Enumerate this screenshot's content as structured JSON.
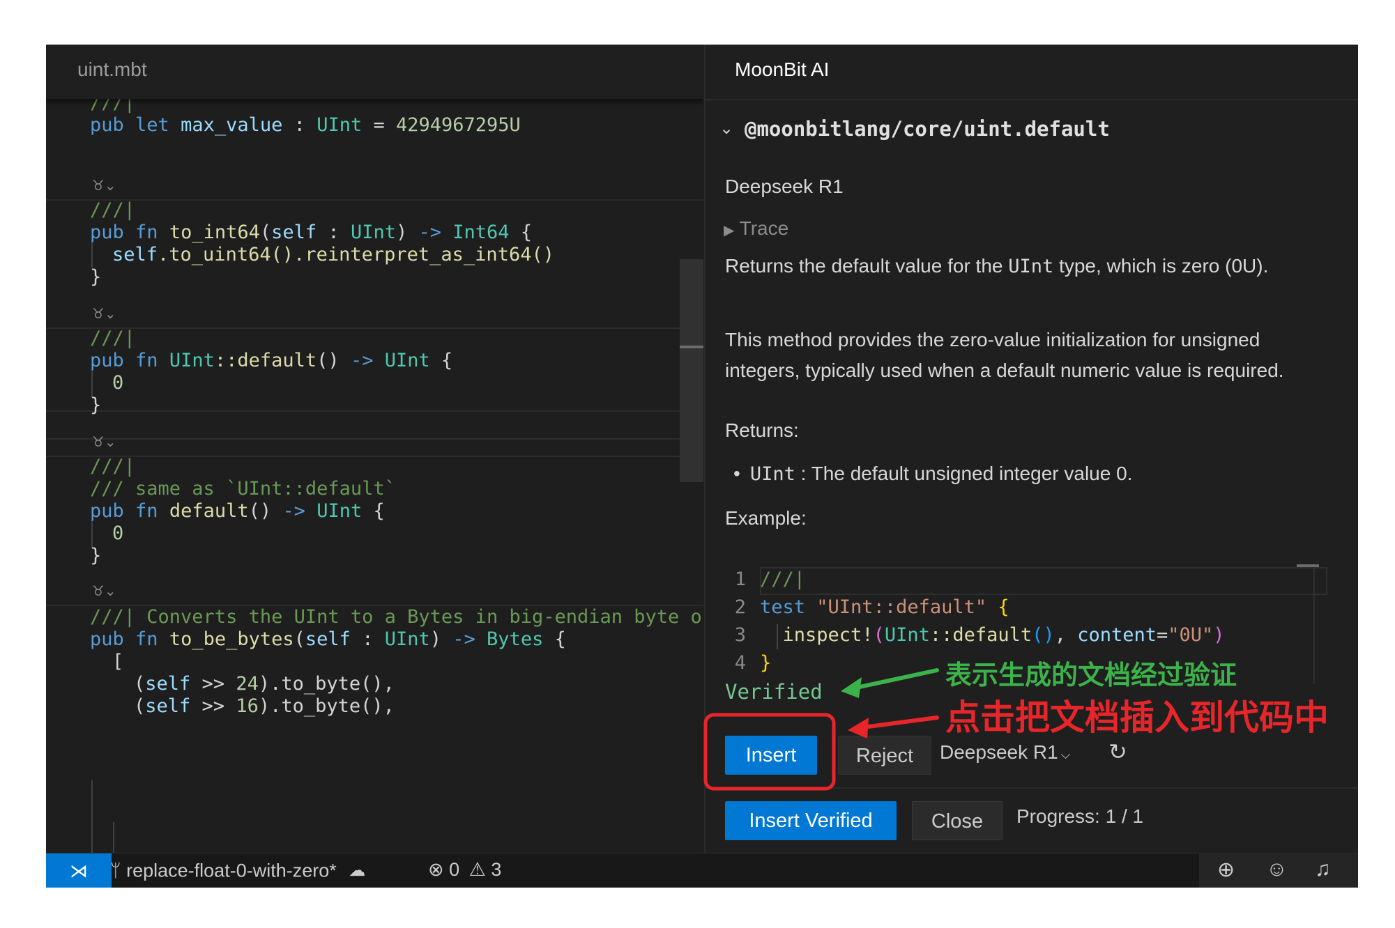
{
  "editor": {
    "tab_label": "uint.mbt",
    "gutter_marker": "♉︎⌄",
    "code": {
      "l0": "///|",
      "l1": {
        "kw": "pub",
        "kw2": "let",
        "name": "max_value",
        "colon": " : ",
        "ty": "UInt",
        "eq": " = ",
        "num": "4294967295U"
      },
      "l2": "///|",
      "l3": {
        "kw": "pub",
        "kw2": "fn",
        "name": "to_int64",
        "p": "(",
        "self": "self",
        "colon": " : ",
        "ty": "UInt",
        "close": ") ",
        "arrow": "->",
        "ret": "Int64",
        "brace": " {"
      },
      "l4": {
        "self": "self",
        "rest": ".to_uint64().reinterpret_as_int64()"
      },
      "l5": "}",
      "l6": "///|",
      "l7": {
        "kw": "pub",
        "kw2": "fn",
        "ty": "UInt",
        "name": "::default",
        "p": "() ",
        "arrow": "->",
        "ret": "UInt",
        "brace": " {"
      },
      "l8": "0",
      "l9": "}",
      "l10": "///|",
      "l11": "/// same as `UInt::default`",
      "l12": {
        "kw": "pub",
        "kw2": "fn",
        "name": "default",
        "p": "() ",
        "arrow": "->",
        "ret": "UInt",
        "brace": " {"
      },
      "l13": "0",
      "l14": "}",
      "l15": "///| Converts the UInt to a Bytes in big-endian byte o",
      "l16": {
        "kw": "pub",
        "kw2": "fn",
        "name": "to_be_bytes",
        "p": "(",
        "self": "self",
        "colon": " : ",
        "ty": "UInt",
        "close": ") ",
        "arrow": "->",
        "ret": "Bytes",
        "brace": " {"
      },
      "l17": "[",
      "l18": {
        "p": "(",
        "self": "self",
        "op": " >> ",
        "num": "24",
        "rest": ").to_byte(),"
      },
      "l19": {
        "p": "(",
        "self": "self",
        "op": " >> ",
        "num": "16",
        "rest": ").to_byte(),"
      }
    }
  },
  "panel": {
    "title": "MoonBit AI",
    "package": "@moonbitlang/core/uint.default",
    "model_name": "Deepseek R1",
    "trace_label": "Trace",
    "desc1_a": "Returns the default value for the ",
    "desc1_code": "UInt",
    "desc1_b": " type, which is zero (0U).",
    "desc2": "This method provides the zero-value initialization for unsigned integers, typically used when a default numeric value is required.",
    "returns_label": "Returns:",
    "returns_code": "UInt",
    "returns_text": " : The default unsigned integer value 0.",
    "example_label": "Example:",
    "example": {
      "n1": "1",
      "n2": "2",
      "n3": "3",
      "n4": "4",
      "l1": "///|",
      "l2_kw": "test",
      "l2_str": " \"UInt::default\"",
      "l2_brace": " {",
      "l3_fn": "inspect!",
      "l3_ty": "UInt",
      "l3_mid": "::default",
      "l3_param": "content",
      "l3_str": "\"0U\"",
      "l4": "}"
    },
    "verified_label": "Verified",
    "insert_label": "Insert",
    "reject_label": "Reject",
    "model_select": "Deepseek R1",
    "insert_verified_label": "Insert Verified",
    "close_label": "Close",
    "progress": "Progress: 1 / 1"
  },
  "statusbar": {
    "branch": "replace-float-0-with-zero*",
    "errors": "0",
    "warnings": "3"
  },
  "annotations": {
    "verified_note": "表示生成的文档经过验证",
    "insert_note": "点击把文档插入到代码中",
    "green": "#3cb34a",
    "red": "#e8262a"
  },
  "colors": {
    "accent": "#0078d4",
    "verified": "#73c991"
  }
}
